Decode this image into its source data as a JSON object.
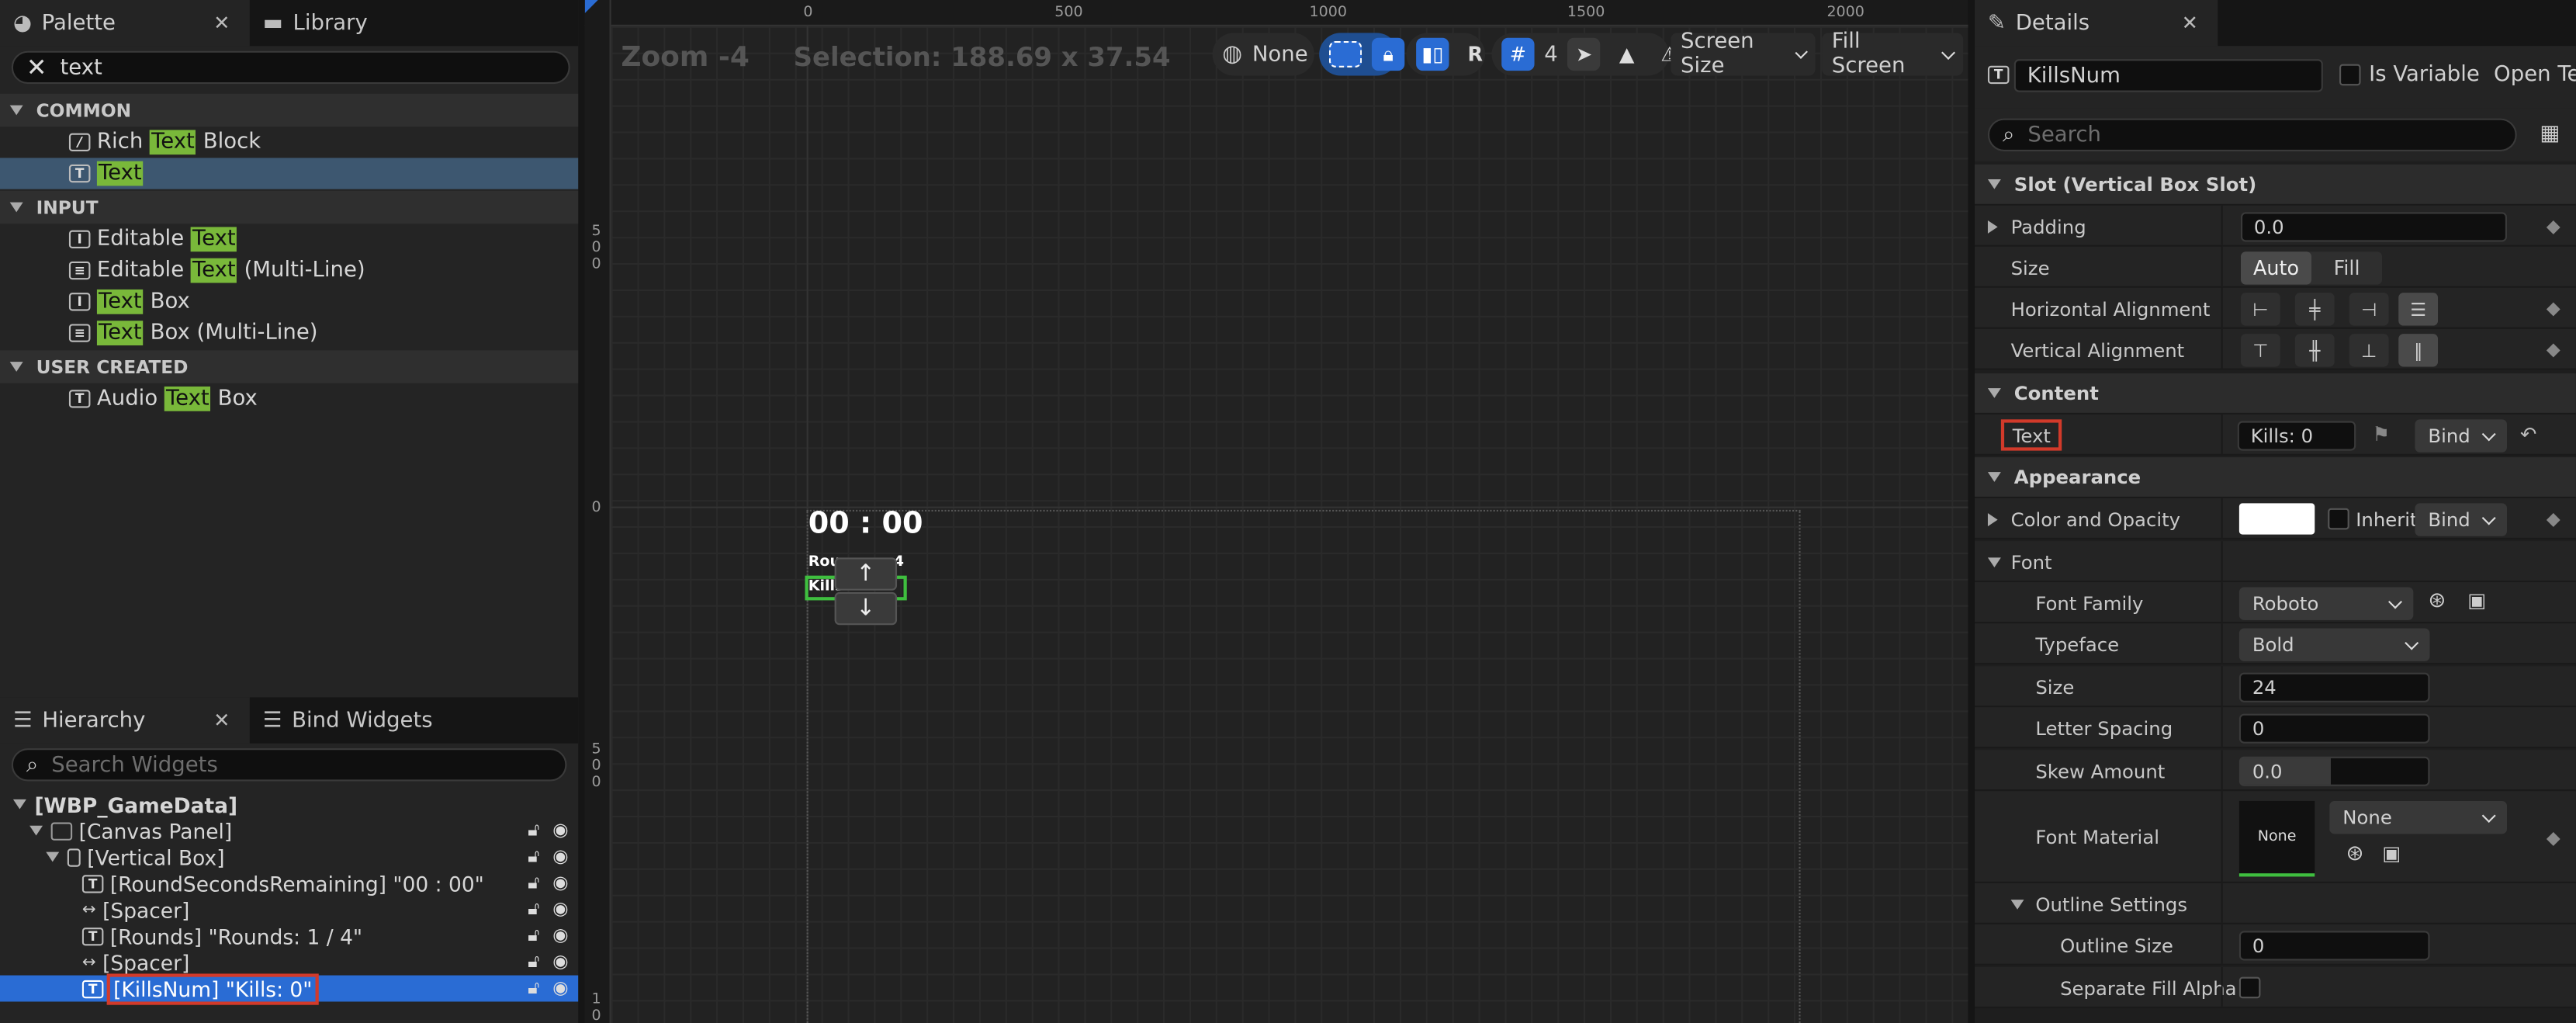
{
  "palette": {
    "tab_label": "Palette",
    "library_tab_label": "Library",
    "search_value": "text",
    "categories": [
      {
        "name": "COMMON",
        "items": [
          {
            "pre": "Rich ",
            "hl": "Text",
            "post": " Block",
            "icon": "rich-text-icon"
          },
          {
            "pre": "",
            "hl": "Text",
            "post": "",
            "icon": "text-icon",
            "selected": true
          }
        ]
      },
      {
        "name": "INPUT",
        "items": [
          {
            "pre": "Editable ",
            "hl": "Text",
            "post": "",
            "icon": "editable-text-icon"
          },
          {
            "pre": "Editable ",
            "hl": "Text",
            "post": " (Multi-Line)",
            "icon": "multiline-text-icon"
          },
          {
            "pre": "",
            "hl": "Text",
            "post": " Box",
            "icon": "text-box-icon"
          },
          {
            "pre": "",
            "hl": "Text",
            "post": " Box (Multi-Line)",
            "icon": "multiline-text-box-icon"
          }
        ]
      },
      {
        "name": "USER CREATED",
        "items": [
          {
            "pre": "Audio ",
            "hl": "Text",
            "post": " Box",
            "icon": "audio-text-box-icon"
          }
        ]
      }
    ]
  },
  "hierarchy": {
    "tab_label": "Hierarchy",
    "bind_tab_label": "Bind Widgets",
    "search_placeholder": "Search Widgets",
    "items": [
      {
        "label": "[WBP_GameData]",
        "depth": 0,
        "icon": "none",
        "bold": true
      },
      {
        "label": "[Canvas Panel]",
        "depth": 1,
        "icon": "canvas-icon"
      },
      {
        "label": "[Vertical Box]",
        "depth": 2,
        "icon": "vertical-box-icon"
      },
      {
        "label": "[RoundSecondsRemaining] \"00 : 00\"",
        "depth": 3,
        "icon": "text-icon"
      },
      {
        "label": "[Spacer]",
        "depth": 3,
        "icon": "spacer-icon"
      },
      {
        "label": "[Rounds] \"Rounds: 1 / 4\"",
        "depth": 3,
        "icon": "text-icon"
      },
      {
        "label": "[Spacer]",
        "depth": 3,
        "icon": "spacer-icon"
      },
      {
        "label": "[KillsNum] \"Kills: 0\"",
        "depth": 3,
        "icon": "text-icon",
        "selected": true
      }
    ]
  },
  "viewport": {
    "zoom_label": "Zoom -4",
    "selection_label": "Selection: 188.69 x 37.54",
    "toolbar": {
      "none_label": "None",
      "r_label": "R",
      "grid_value": "4",
      "screen_size_label": "Screen Size",
      "fill_screen_label": "Fill Screen"
    },
    "ruler_top_ticks": [
      "0",
      "500",
      "1000",
      "1500",
      "2000"
    ],
    "ruler_left_ticks": [
      "500",
      "0",
      "500",
      "1"
    ],
    "ruler_left_lastzero": "0",
    "widget_time_text": "00 : 00",
    "widget_rounds_text": "Rou",
    "widget_rounds_suffix": "4",
    "widget_kills_text": "Kills",
    "up_arrow": "↑",
    "down_arrow": "↓"
  },
  "details": {
    "tab_label": "Details",
    "name_value": "KillsNum",
    "is_variable_label": "Is Variable",
    "open_text_label": "Open Tex",
    "search_placeholder": "Search",
    "slot_section": "Slot (Vertical Box Slot)",
    "padding_label": "Padding",
    "padding_value": "0.0",
    "size_label": "Size",
    "size_auto": "Auto",
    "size_fill": "Fill",
    "halign_label": "Horizontal Alignment",
    "valign_label": "Vertical Alignment",
    "content_section": "Content",
    "text_label": "Text",
    "text_value": "Kills: 0",
    "bind_label": "Bind",
    "appearance_section": "Appearance",
    "color_label": "Color and Opacity",
    "inherit_label": "Inherit",
    "font_section": "Font",
    "font_family_label": "Font Family",
    "font_family_value": "Roboto",
    "typeface_label": "Typeface",
    "typeface_value": "Bold",
    "font_size_label": "Size",
    "font_size_value": "24",
    "letter_spacing_label": "Letter Spacing",
    "letter_spacing_value": "0",
    "skew_label": "Skew Amount",
    "skew_value": "0.0",
    "font_material_label": "Font Material",
    "font_material_thumb": "None",
    "font_material_value": "None",
    "outline_section": "Outline Settings",
    "outline_size_label": "Outline Size",
    "outline_size_value": "0",
    "separate_fill_label": "Separate Fill Alpha"
  },
  "colors": {
    "highlight": "#79b83a",
    "selection_blue": "#2a6cd4",
    "annotation_red": "#d23a2a",
    "palette_selected": "#3d5770"
  }
}
